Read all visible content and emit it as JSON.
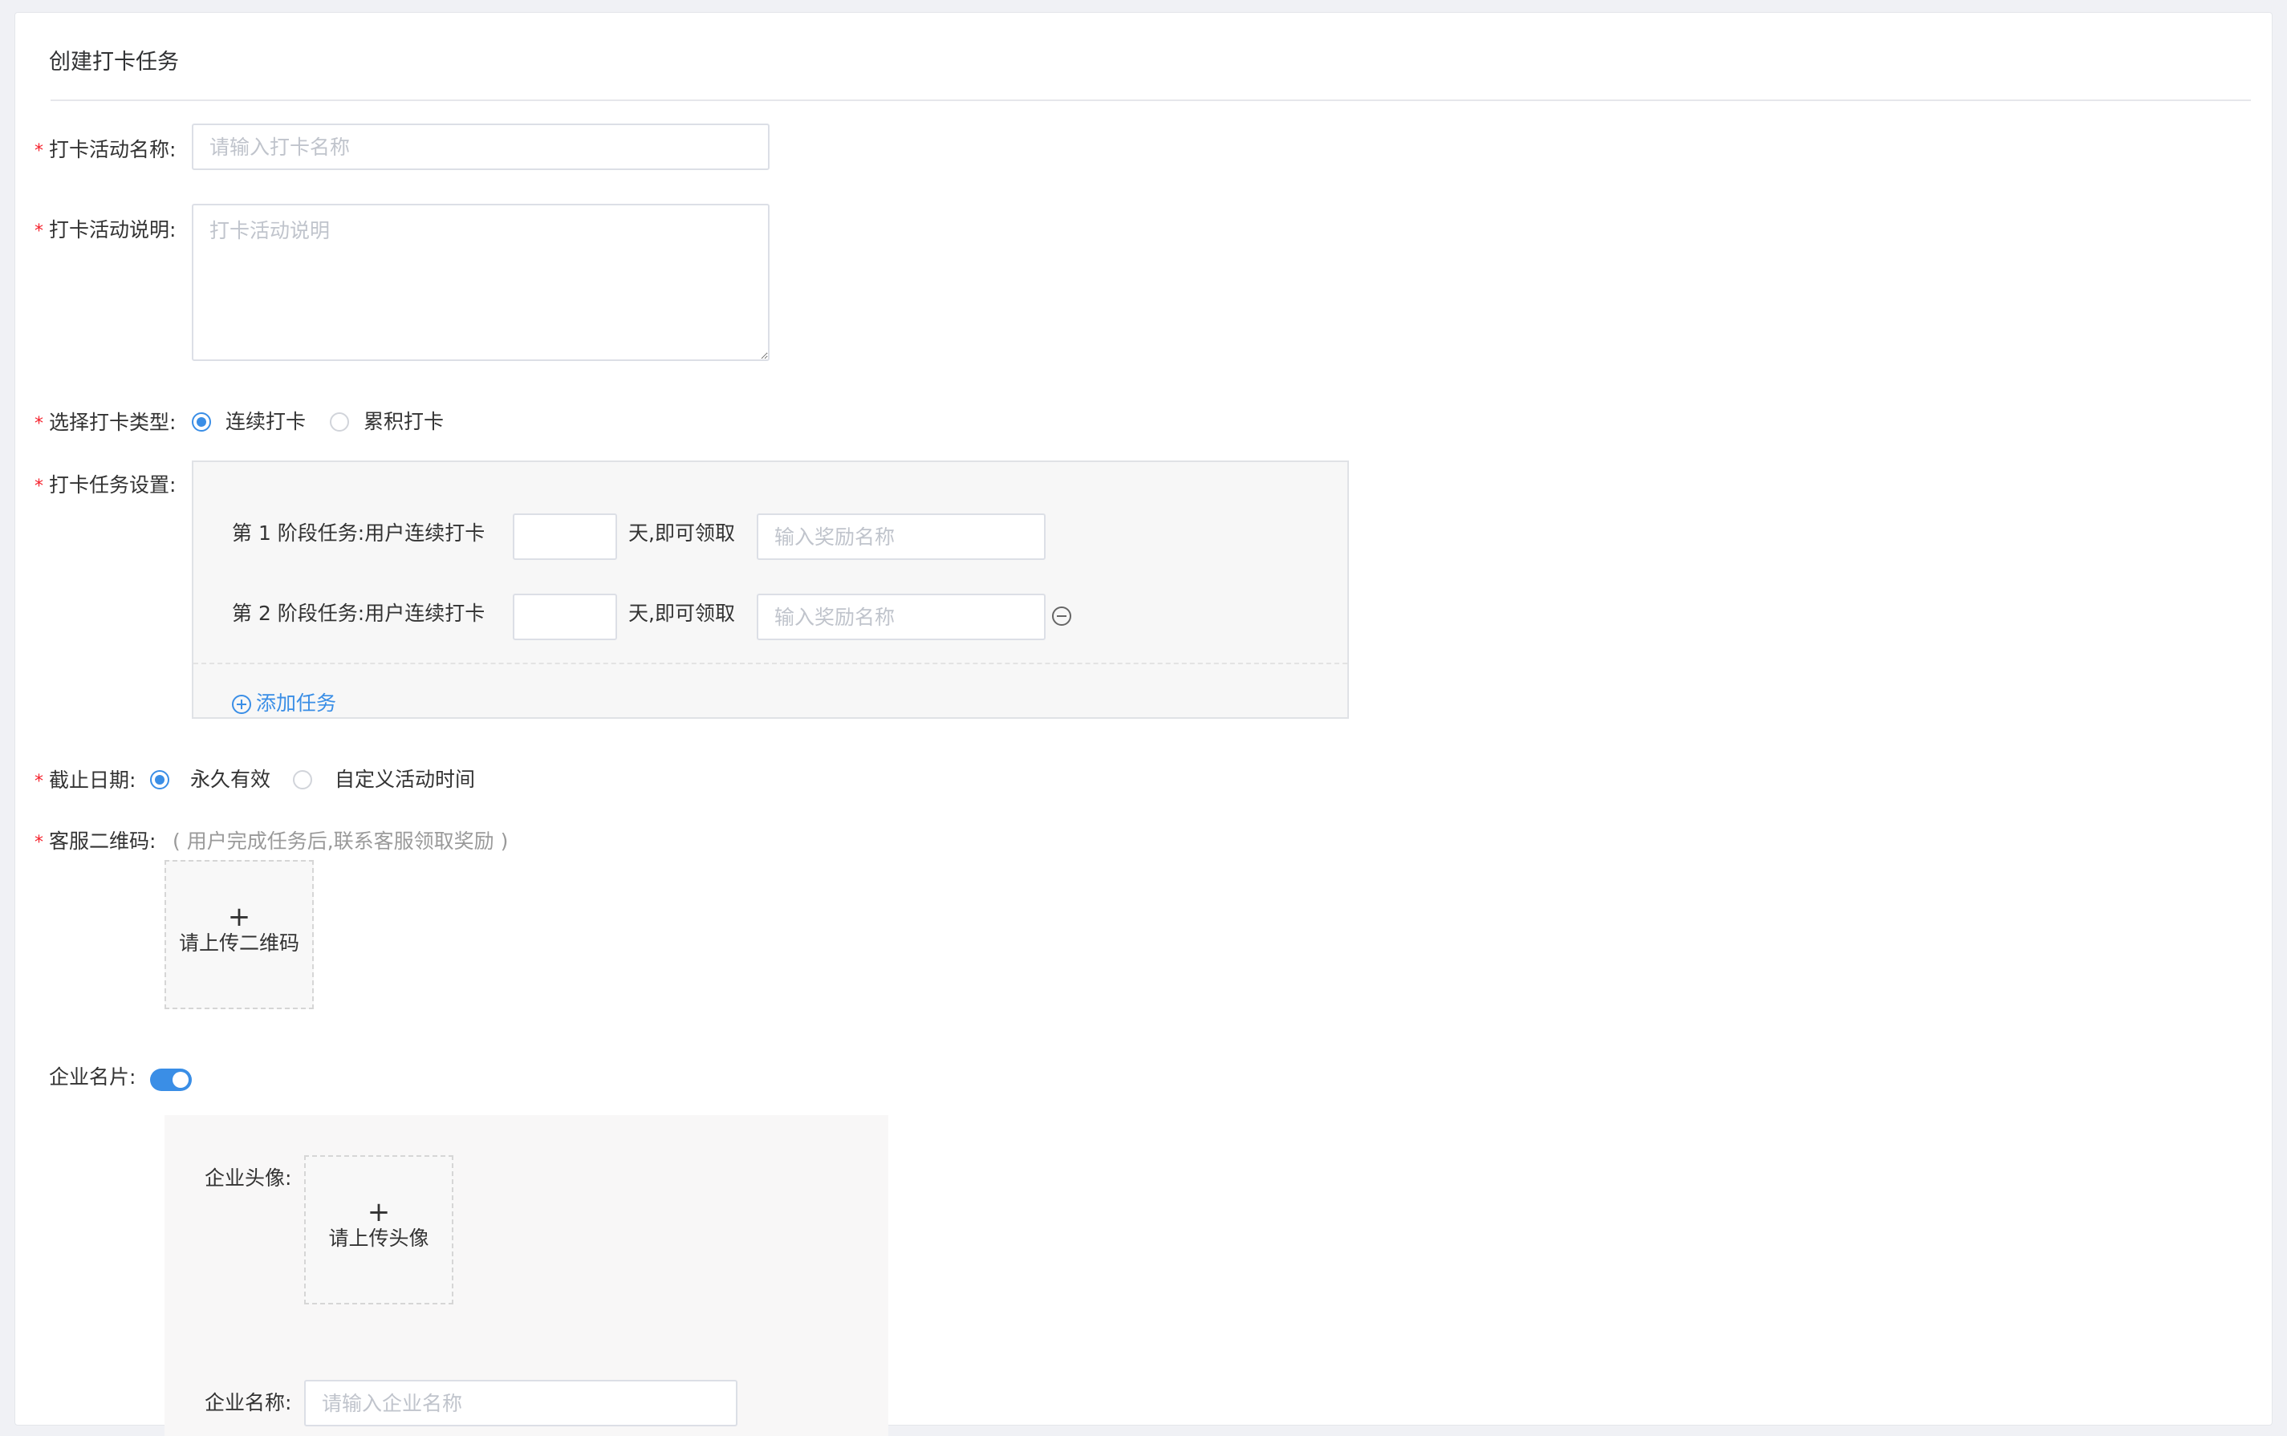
{
  "page": {
    "title": "创建打卡任务"
  },
  "form": {
    "name": {
      "label": "打卡活动名称:",
      "placeholder": "请输入打卡名称",
      "value": ""
    },
    "desc": {
      "label": "打卡活动说明:",
      "placeholder": "打卡活动说明",
      "value": ""
    },
    "type": {
      "label": "选择打卡类型:",
      "options": [
        {
          "label": "连续打卡",
          "selected": true
        },
        {
          "label": "累积打卡",
          "selected": false
        }
      ]
    },
    "tasks": {
      "label": "打卡任务设置:",
      "items": [
        {
          "prefix": "第 1 阶段任务:用户连续打卡",
          "days": "",
          "suffix": "天,即可领取",
          "reward_placeholder": "输入奖励名称",
          "removable": false
        },
        {
          "prefix": "第 2 阶段任务:用户连续打卡",
          "days": "",
          "suffix": "天,即可领取",
          "reward_placeholder": "输入奖励名称",
          "removable": true
        }
      ],
      "add_label": "添加任务"
    },
    "deadline": {
      "label": "截止日期:",
      "options": [
        {
          "label": "永久有效",
          "selected": true
        },
        {
          "label": "自定义活动时间",
          "selected": false
        }
      ]
    },
    "qrcode": {
      "label": "客服二维码:",
      "hint": "( 用户完成任务后,联系客服领取奖励 )",
      "upload_label": "请上传二维码"
    },
    "card": {
      "label": "企业名片:",
      "enabled": true,
      "avatar_label": "企业头像:",
      "avatar_upload_label": "请上传头像",
      "company_name_label": "企业名称:",
      "company_name_placeholder": "请输入企业名称"
    }
  },
  "colors": {
    "accent": "#3a8ee6",
    "required": "#f5222d"
  }
}
